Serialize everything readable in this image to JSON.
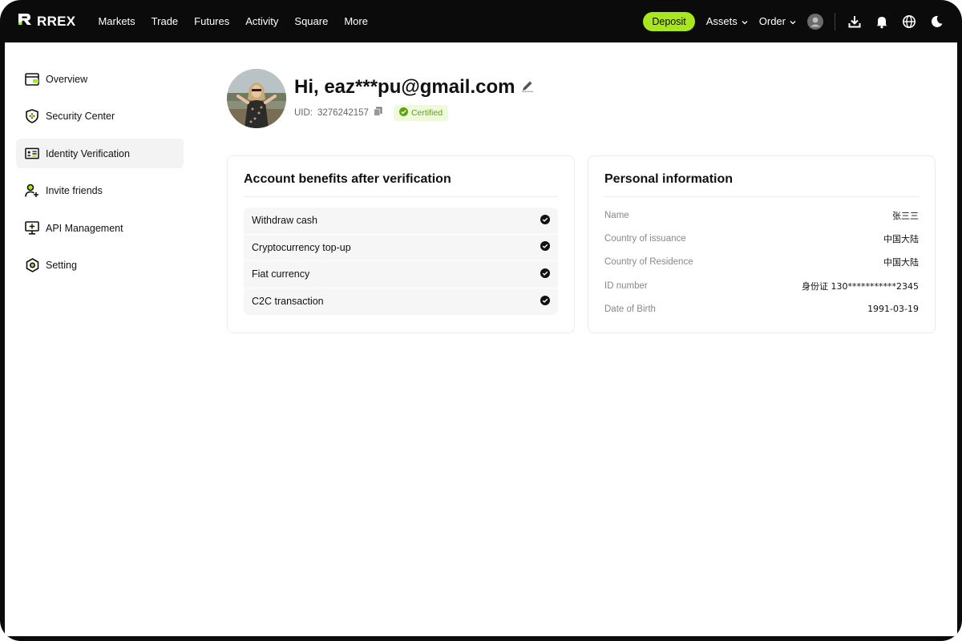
{
  "brand": {
    "name": "RREX",
    "accent": "#a8e61d"
  },
  "nav": [
    "Markets",
    "Trade",
    "Futures",
    "Activity",
    "Square",
    "More"
  ],
  "top_right": {
    "deposit_label": "Deposit",
    "assets_label": "Assets",
    "order_label": "Order",
    "icons": [
      "user-avatar-icon",
      "download-icon",
      "bell-icon",
      "globe-icon",
      "moon-icon"
    ]
  },
  "sidebar": {
    "items": [
      {
        "label": "Overview",
        "icon": "wallet-icon"
      },
      {
        "label": "Security Center",
        "icon": "shield-icon"
      },
      {
        "label": "Identity Verification",
        "icon": "id-card-icon",
        "active": true
      },
      {
        "label": "Invite friends",
        "icon": "add-user-icon"
      },
      {
        "label": "API Management",
        "icon": "monitor-icon"
      },
      {
        "label": "Setting",
        "icon": "settings-icon"
      }
    ]
  },
  "profile": {
    "greeting": "Hi, eaz***pu@gmail.com",
    "uid_label": "UID:",
    "uid_value": "3276242157",
    "badge": "Certified"
  },
  "benefits": {
    "title": "Account benefits after verification",
    "items": [
      "Withdraw cash",
      "Cryptocurrency top-up",
      "Fiat currency",
      "C2C transaction"
    ]
  },
  "personal": {
    "title": "Personal information",
    "rows": [
      {
        "label": "Name",
        "value": "张三三"
      },
      {
        "label": "Country of issuance",
        "value": "中国大陆"
      },
      {
        "label": "Country of Residence",
        "value": "中国大陆"
      },
      {
        "label": "ID number",
        "value": "身份证 130***********2345"
      },
      {
        "label": "Date of Birth",
        "value": "1991-03-19"
      }
    ]
  }
}
